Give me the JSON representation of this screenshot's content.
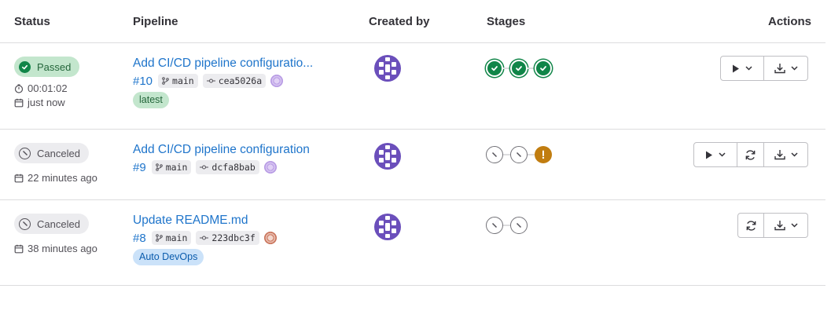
{
  "columns": {
    "status": "Status",
    "pipeline": "Pipeline",
    "created_by": "Created by",
    "stages": "Stages",
    "actions": "Actions"
  },
  "pipelines": [
    {
      "status": "Passed",
      "status_kind": "success",
      "duration": "00:01:02",
      "finished": "just now",
      "title": "Add CI/CD pipeline configuratio...",
      "id": "#10",
      "branch": "main",
      "commit": "cea5026a",
      "label": "latest",
      "stages": [
        "success",
        "success",
        "success"
      ],
      "actions": [
        "run-manual",
        "download-artifacts"
      ]
    },
    {
      "status": "Canceled",
      "status_kind": "canceled",
      "finished": "22 minutes ago",
      "title": "Add CI/CD pipeline configuration",
      "id": "#9",
      "branch": "main",
      "commit": "dcfa8bab",
      "stages": [
        "canceled",
        "canceled",
        "warning"
      ],
      "actions": [
        "run-manual",
        "retry",
        "download-artifacts"
      ]
    },
    {
      "status": "Canceled",
      "status_kind": "canceled",
      "finished": "38 minutes ago",
      "title": "Update README.md",
      "id": "#8",
      "branch": "main",
      "commit": "223dbc3f",
      "label": "Auto DevOps",
      "stages": [
        "canceled",
        "canceled"
      ],
      "actions": [
        "retry",
        "download-artifacts"
      ]
    }
  ],
  "colors": {
    "link": "#1f75cb",
    "success": "#108548",
    "warning": "#c17d10",
    "avatar": "#6b4fbb",
    "border": "#dcdcde"
  }
}
